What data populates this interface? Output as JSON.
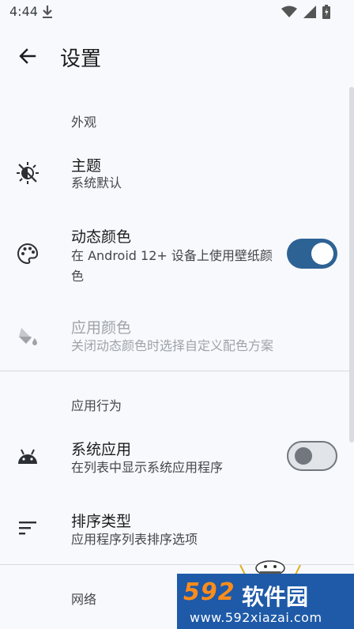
{
  "status_bar": {
    "time": "4:44"
  },
  "app_bar": {
    "title": "设置"
  },
  "sections": {
    "appearance": "外观",
    "behavior": "应用行为",
    "network": "网络"
  },
  "items": {
    "theme": {
      "title": "主题",
      "subtitle": "系统默认"
    },
    "dynamic_color": {
      "title": "动态颜色",
      "subtitle": "在 Android 12+ 设备上使用壁纸颜色",
      "enabled": true
    },
    "app_color": {
      "title": "应用颜色",
      "subtitle": "关闭动态颜色时选择自定义配色方案"
    },
    "system_apps": {
      "title": "系统应用",
      "subtitle": "在列表中显示系统应用程序",
      "enabled": false
    },
    "sort_type": {
      "title": "排序类型",
      "subtitle": "应用程序列表排序选项"
    }
  },
  "watermark": {
    "logo": "592",
    "brand": "软件园",
    "url": "www.592xiazai.com"
  },
  "colors": {
    "accent": "#2d6295",
    "background": "#f7f9fc"
  }
}
